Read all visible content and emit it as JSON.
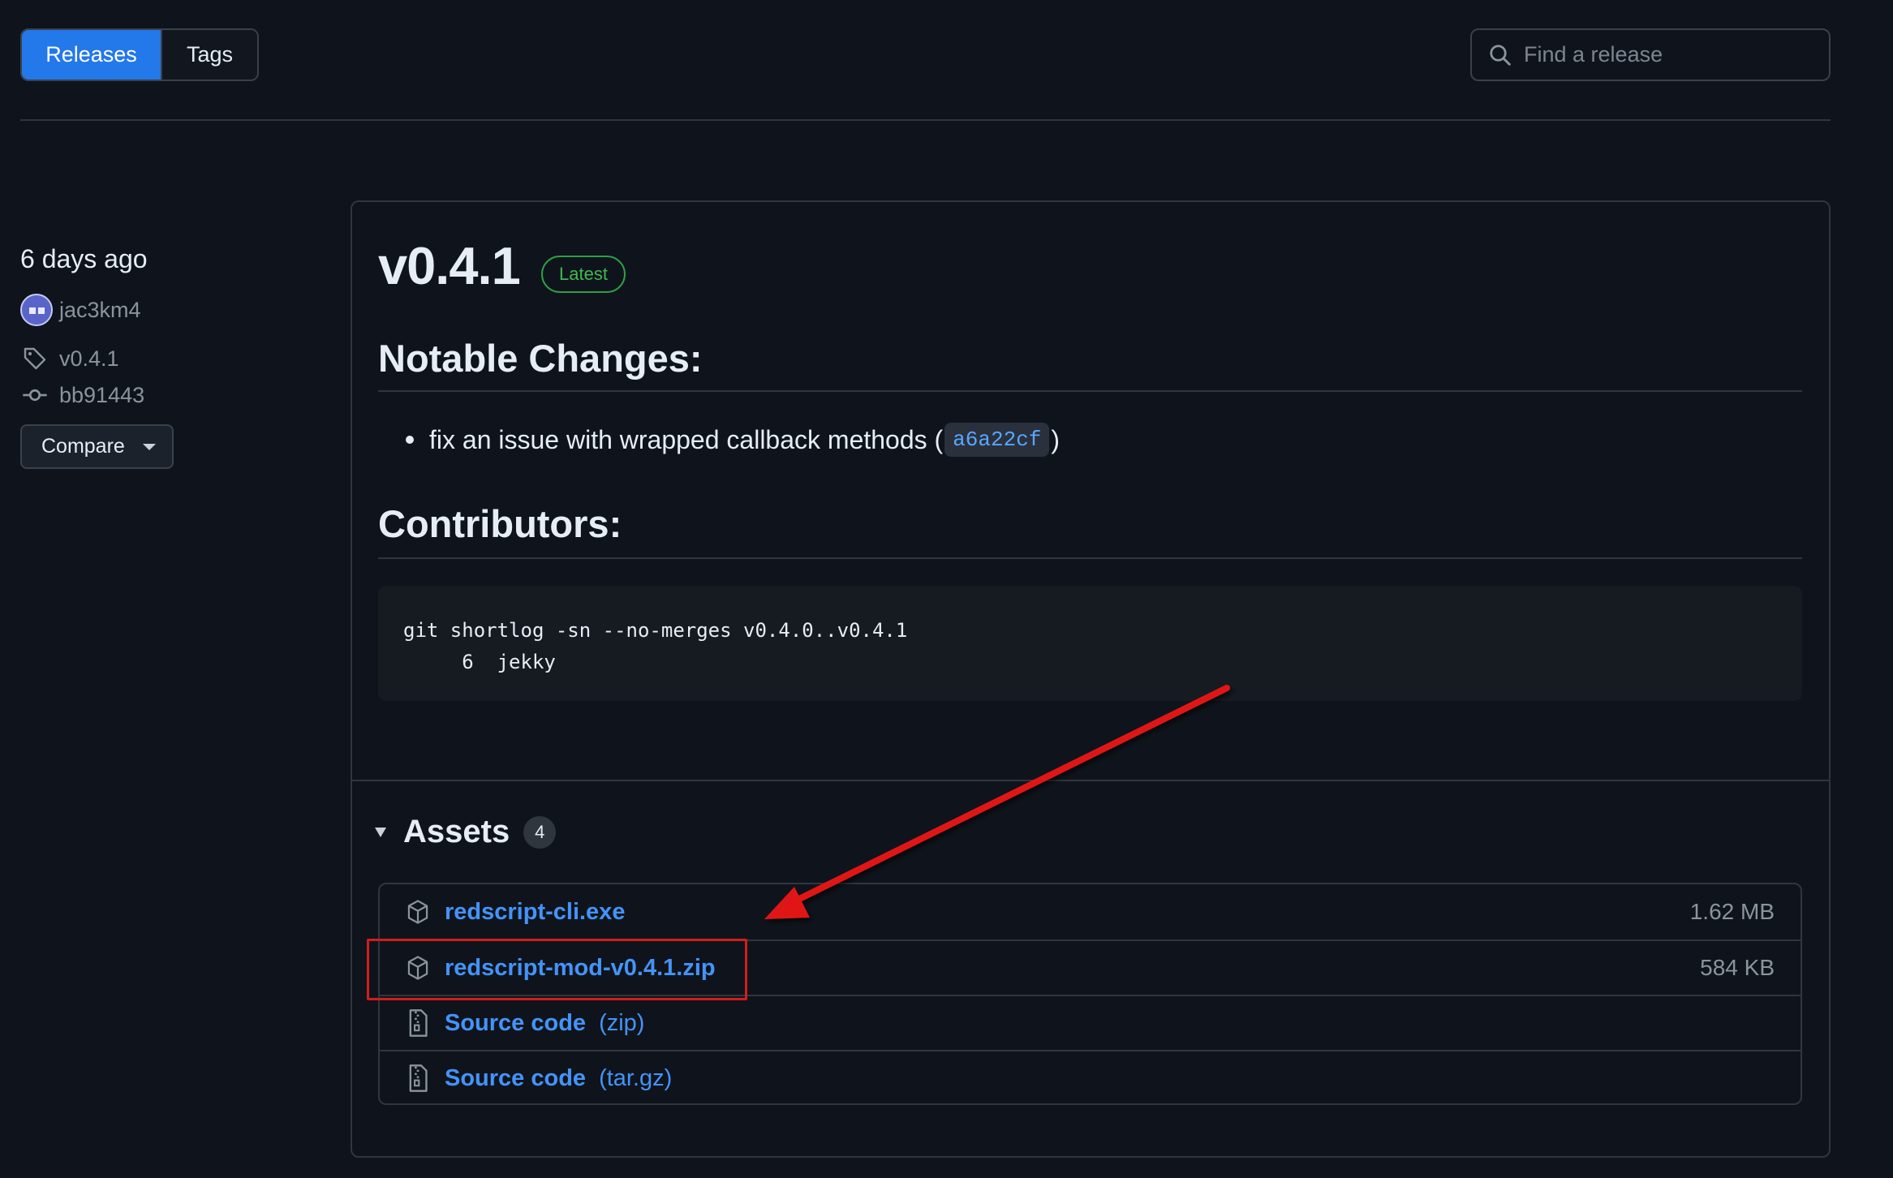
{
  "top_bar": {
    "tabs": [
      {
        "label": "Releases",
        "active": true
      },
      {
        "label": "Tags",
        "active": false
      }
    ],
    "search": {
      "placeholder": "Find a release",
      "value": "",
      "icon": "search-icon"
    }
  },
  "meta": {
    "date": "6 days ago",
    "author": "jac3km4",
    "tag": "v0.4.1",
    "commit": "bb91443",
    "compare_label": "Compare"
  },
  "release": {
    "version": "v0.4.1",
    "latest_badge": "Latest",
    "notable_heading": "Notable Changes:",
    "change_text_before": "fix an issue with wrapped callback methods (",
    "change_commit": "a6a22cf",
    "change_text_after": ")",
    "contributors_heading": "Contributors:",
    "code_line1": "git shortlog -sn --no-merges v0.4.0..v0.4.1",
    "code_line2": "     6  jekky"
  },
  "assets": {
    "title": "Assets",
    "count": "4",
    "items": [
      {
        "name": "redscript-cli.exe",
        "suffix": "",
        "size": "1.62 MB",
        "icon": "package-icon"
      },
      {
        "name": "redscript-mod-v0.4.1.zip",
        "suffix": "",
        "size": "584 KB",
        "icon": "package-icon"
      },
      {
        "name": "Source code",
        "suffix": "(zip)",
        "size": "",
        "icon": "file-zip-icon"
      },
      {
        "name": "Source code",
        "suffix": "(tar.gz)",
        "size": "",
        "icon": "file-zip-icon"
      }
    ]
  },
  "annotation": {
    "highlight_color": "#d11d1d",
    "arrow_color": "#e01818"
  },
  "colors": {
    "accent": "#2378ea",
    "link": "#4493f8",
    "success": "#3fb950",
    "background": "#0f141c"
  }
}
